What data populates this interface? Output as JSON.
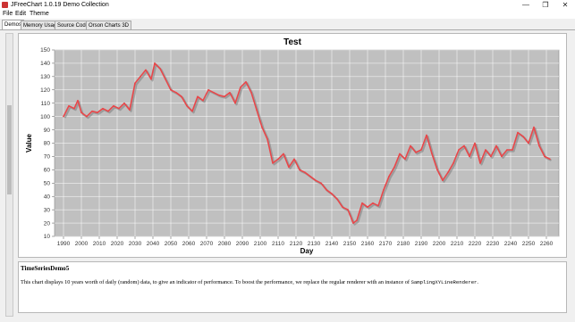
{
  "window": {
    "title": "JFreeChart 1.0.19 Demo Collection",
    "minimize_glyph": "—",
    "maximize_glyph": "❐",
    "close_glyph": "✕"
  },
  "menu": {
    "items": [
      "File",
      "Edit",
      "Theme"
    ]
  },
  "tabs": [
    {
      "label": "Demos",
      "active": true
    },
    {
      "label": "Memory Usage",
      "active": false
    },
    {
      "label": "Source Code",
      "active": false
    },
    {
      "label": "Orson Charts 3D",
      "active": false
    }
  ],
  "chart_data": {
    "type": "line",
    "title": "Test",
    "xlabel": "Day",
    "ylabel": "Value",
    "xlim": [
      1985,
      2267
    ],
    "ylim": [
      10,
      150
    ],
    "xticks": [
      1990,
      2000,
      2010,
      2020,
      2030,
      2040,
      2050,
      2060,
      2070,
      2080,
      2090,
      2100,
      2110,
      2120,
      2130,
      2140,
      2150,
      2160,
      2170,
      2180,
      2190,
      2200,
      2210,
      2220,
      2230,
      2240,
      2250,
      2260
    ],
    "yticks": [
      10,
      20,
      30,
      40,
      50,
      60,
      70,
      80,
      90,
      100,
      110,
      120,
      130,
      140,
      150
    ],
    "grid": true,
    "legend": "none",
    "series": [
      {
        "color": "#e8474a",
        "x": [
          1990,
          1993,
          1996,
          1998,
          2000,
          2003,
          2006,
          2009,
          2012,
          2015,
          2018,
          2021,
          2024,
          2027,
          2030,
          2033,
          2036,
          2039,
          2041,
          2044,
          2047,
          2050,
          2053,
          2056,
          2059,
          2062,
          2065,
          2068,
          2071,
          2074,
          2077,
          2080,
          2083,
          2086,
          2089,
          2092,
          2095,
          2098,
          2101,
          2104,
          2107,
          2110,
          2113,
          2116,
          2119,
          2122,
          2125,
          2128,
          2131,
          2134,
          2137,
          2140,
          2143,
          2146,
          2149,
          2152,
          2154,
          2157,
          2160,
          2163,
          2166,
          2169,
          2172,
          2175,
          2178,
          2181,
          2184,
          2187,
          2190,
          2193,
          2196,
          2199,
          2202,
          2205,
          2208,
          2211,
          2214,
          2217,
          2220,
          2223,
          2226,
          2229,
          2232,
          2235,
          2238,
          2241,
          2244,
          2247,
          2250,
          2253,
          2256,
          2259,
          2262
        ],
        "values": [
          100,
          108,
          106,
          112,
          103,
          100,
          104,
          103,
          106,
          104,
          108,
          106,
          110,
          105,
          125,
          130,
          135,
          128,
          140,
          136,
          128,
          120,
          118,
          115,
          108,
          104,
          115,
          112,
          120,
          118,
          116,
          115,
          118,
          110,
          122,
          126,
          118,
          105,
          92,
          83,
          65,
          68,
          72,
          62,
          68,
          60,
          58,
          55,
          52,
          50,
          45,
          42,
          38,
          32,
          30,
          20,
          22,
          35,
          32,
          35,
          33,
          45,
          55,
          62,
          72,
          68,
          78,
          73,
          75,
          86,
          72,
          60,
          52,
          58,
          65,
          75,
          78,
          70,
          80,
          65,
          75,
          70,
          78,
          70,
          75,
          75,
          88,
          85,
          80,
          92,
          78,
          70,
          68
        ]
      }
    ]
  },
  "description": {
    "heading": "TimeSeriesDemo5",
    "text_before": "This chart displays 10 years worth of daily (random) data, to give an indicator of performance. To boost the performance, we replace the regular renderer with an instance of ",
    "code": "SamplingXYLineRenderer",
    "text_after": "."
  }
}
